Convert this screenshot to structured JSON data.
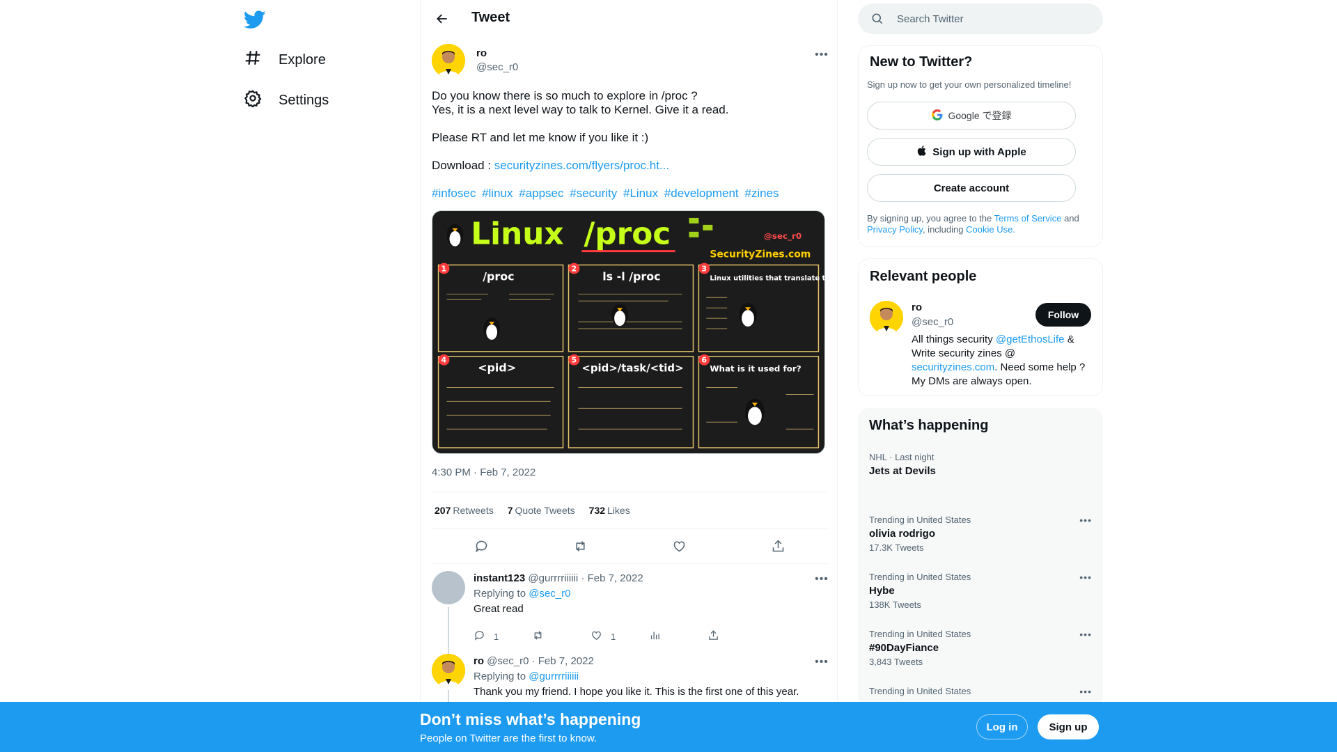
{
  "nav": {
    "explore_label": "Explore",
    "settings_label": "Settings"
  },
  "header": {
    "title": "Tweet"
  },
  "tweet": {
    "author_name": "ro",
    "author_handle": "@sec_r0",
    "line1": "Do you know there is so much to explore in /proc ?",
    "line2": "Yes, it is a next level way to talk to Kernel. Give it a read.",
    "line3": "Please RT and let me know if you like it :)",
    "download_label": "Download :",
    "download_link": "securityzines.com/flyers/proc.ht...",
    "hashtags": [
      "#infosec",
      "#linux",
      "#appsec",
      "#security",
      "#Linux",
      "#development",
      "#zines"
    ],
    "timestamp": "4:30 PM · Feb 7, 2022",
    "retweets_count": "207",
    "retweets_label": "Retweets",
    "quotes_count": "7",
    "quotes_label": "Quote Tweets",
    "likes_count": "732",
    "likes_label": "Likes"
  },
  "media": {
    "title_left": "Linux",
    "title_right": "/proc",
    "handle_tag": "@sec_r0",
    "brand": "SecurityZines.com",
    "panels": [
      {
        "num": "1",
        "title": "/proc"
      },
      {
        "num": "2",
        "title": "ls -l /proc"
      },
      {
        "num": "3",
        "title": "Linux utilities that translate to commands"
      },
      {
        "num": "4",
        "title": "<pid>"
      },
      {
        "num": "5",
        "title": "<pid>/task/<tid>"
      },
      {
        "num": "6",
        "title": "What is it used for?"
      }
    ]
  },
  "replies": [
    {
      "name": "instant123",
      "handle": "@gurrrriiiiii",
      "date": "· Feb 7, 2022",
      "replying_label": "Replying to",
      "replying_to": "@sec_r0",
      "text": "Great read",
      "reply_count": "1",
      "like_count": "1"
    },
    {
      "name": "ro",
      "handle": "@sec_r0",
      "date": "· Feb 7, 2022",
      "replying_label": "Replying to",
      "replying_to": "@gurrrriiiiii",
      "text": "Thank you my friend. I hope you like it. This is the first one of this year."
    }
  ],
  "search": {
    "placeholder": "Search Twitter"
  },
  "new_to_twitter": {
    "title": "New to Twitter?",
    "subtitle": "Sign up now to get your own personalized timeline!",
    "google_label": "Google で登録",
    "apple_label": "Sign up with Apple",
    "create_label": "Create account",
    "legal_prefix": "By signing up, you agree to the",
    "tos": "Terms of Service",
    "and": "and",
    "privacy": "Privacy Policy",
    "including": ", including",
    "cookie": "Cookie Use."
  },
  "relevant": {
    "title": "Relevant people",
    "name": "ro",
    "handle": "@sec_r0",
    "follow_label": "Follow",
    "bio_1": "All things security",
    "bio_link1": "@getEthosLife",
    "bio_2": "& Write security zines @",
    "bio_link2": "securityzines.com",
    "bio_3": ". Need some help ? My DMs are always open."
  },
  "happening": {
    "title": "What’s happening",
    "trends": [
      {
        "context": "NHL · Last night",
        "topic": "Jets at Devils",
        "count": ""
      },
      {
        "context": "Trending in United States",
        "topic": "olivia rodrigo",
        "count": "17.3K Tweets"
      },
      {
        "context": "Trending in United States",
        "topic": "Hybe",
        "count": "138K Tweets"
      },
      {
        "context": "Trending in United States",
        "topic": "#90DayFiance",
        "count": "3,843 Tweets"
      },
      {
        "context": "Trending in United States",
        "topic": "",
        "count": ""
      }
    ]
  },
  "bottom": {
    "title": "Don’t miss what’s happening",
    "subtitle": "People on Twitter are the first to know.",
    "login_label": "Log in",
    "signup_label": "Sign up"
  },
  "colors": {
    "accent": "#1d9bf0",
    "text": "#0f1419",
    "muted": "#536471"
  }
}
